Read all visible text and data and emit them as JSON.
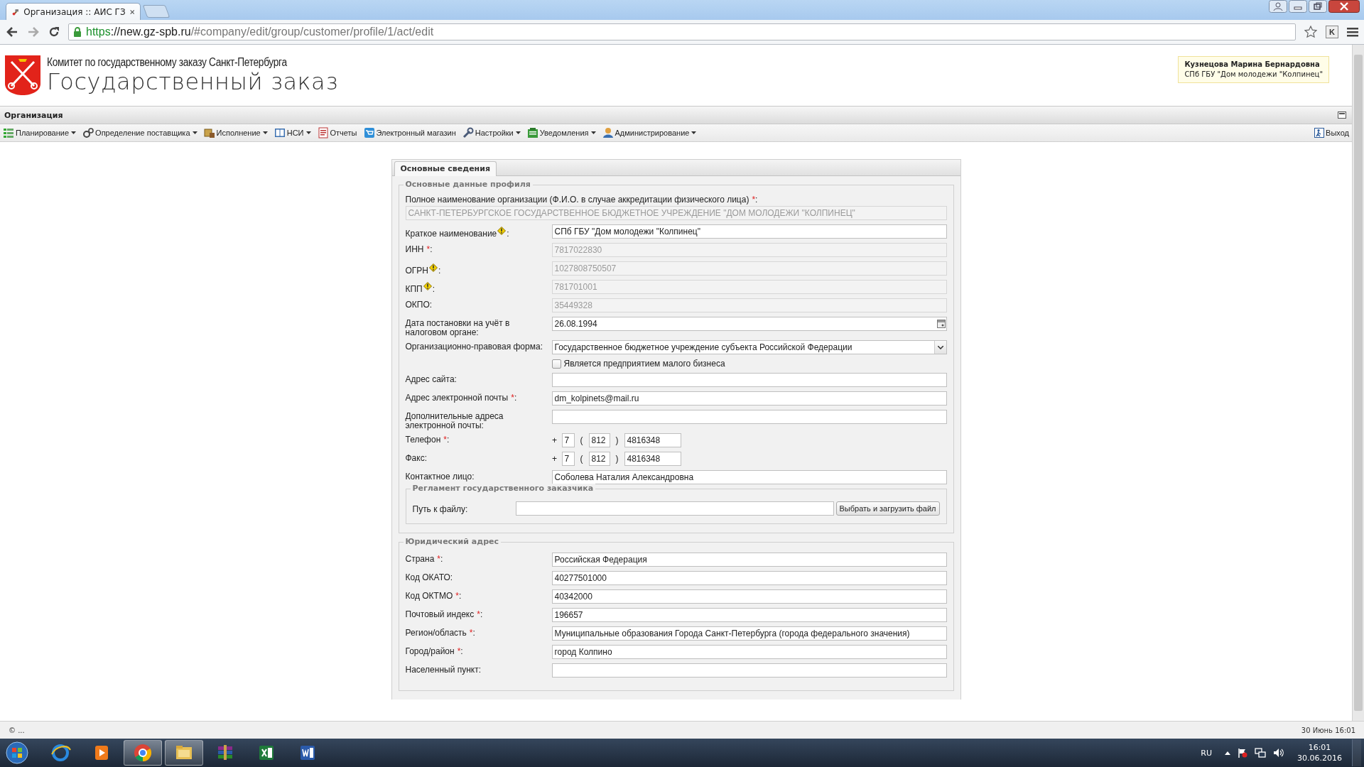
{
  "browser": {
    "tab_title": "Организация :: АИС ГЗ",
    "url_scheme": "https",
    "url_rest": "://new.gz-spb.ru",
    "url_path": "/#company/edit/group/customer/profile/1/act/edit",
    "ext_label": "K"
  },
  "header": {
    "subtitle": "Комитет по государственному заказу Санкт-Петербурга",
    "title": "Государственный заказ",
    "user_name": "Кузнецова Марина Бернардовна",
    "user_org": "СПб ГБУ \"Дом молодежи \"Колпинец\""
  },
  "section_title": "Организация",
  "menu": [
    {
      "label": "Планирование",
      "dropdown": true
    },
    {
      "label": "Определение поставщика",
      "dropdown": true
    },
    {
      "label": "Исполнение",
      "dropdown": true
    },
    {
      "label": "НСИ",
      "dropdown": true
    },
    {
      "label": "Отчеты",
      "dropdown": false
    },
    {
      "label": "Электронный магазин",
      "dropdown": false
    },
    {
      "label": "Настройки",
      "dropdown": true
    },
    {
      "label": "Уведомления",
      "dropdown": true
    },
    {
      "label": "Администрирование",
      "dropdown": true
    }
  ],
  "logout": "Выход",
  "tabs": [
    {
      "label": "Основные сведения",
      "selected": true
    }
  ],
  "fieldsets": [
    {
      "legend": "Основные данные профиля",
      "fields": [
        {
          "kind": "wide",
          "label": "Полное наименование организации (Ф.И.О. в случае аккредитации физического лица)",
          "mark": "*",
          "tail": ":",
          "value": "САНКТ-ПЕТЕРБУРГСКОЕ ГОСУДАРСТВЕННОЕ БЮДЖЕТНОЕ УЧРЕЖДЕНИЕ \"ДОМ МОЛОДЕЖИ \"КОЛПИНЕЦ\"",
          "disabled": true
        },
        {
          "kind": "text",
          "label": "Краткое наименование",
          "warning": true,
          "tail": ":",
          "value": "СПб ГБУ \"Дом молодежи \"Колпинец\"",
          "disabled": false
        },
        {
          "kind": "text",
          "label": "ИНН",
          "mark": "*",
          "tail": ":",
          "value": "7817022830",
          "disabled": true
        },
        {
          "kind": "text",
          "label": "ОГРН",
          "warning": true,
          "tail": ":",
          "value": "1027808750507",
          "disabled": true
        },
        {
          "kind": "text",
          "label": "КПП",
          "warning": true,
          "tail": ":",
          "value": "781701001",
          "disabled": true
        },
        {
          "kind": "text",
          "label": "ОКПО:",
          "value": "35449328",
          "disabled": true
        },
        {
          "kind": "date",
          "label": "Дата постановки на учёт в налоговом органе:",
          "value": "26.08.1994",
          "disabled": false
        },
        {
          "kind": "select",
          "label": "Организационно-правовая форма:",
          "value": "Государственное бюджетное учреждение субъекта Российской Федерации",
          "disabled": false
        },
        {
          "kind": "checkbox",
          "label": "Является предприятием малого бизнеса",
          "checked": false
        },
        {
          "kind": "text",
          "label": "Адрес сайта:",
          "disabled": false
        },
        {
          "kind": "text",
          "label": "Адрес электронной почты",
          "mark": "*",
          "tail": ":",
          "value": "dm_kolpinets@mail.ru",
          "disabled": false
        },
        {
          "kind": "text",
          "label": "Дополнительные адреса электронной почты:",
          "disabled": false
        },
        {
          "kind": "phone",
          "label": "Телефон",
          "mark": "*",
          "tail": ":",
          "plus": "+",
          "open": "(",
          "close": ")",
          "country": "7",
          "area": "812",
          "number": "4816348"
        },
        {
          "kind": "phone",
          "label": "Факс:",
          "plus": "+",
          "open": "(",
          "close": ")",
          "country": "7",
          "area": "812",
          "number": "4816348"
        },
        {
          "kind": "text",
          "label": "Контактное лицо:",
          "value": "Соболева Наталия Александровна",
          "disabled": false
        },
        {
          "kind": "file",
          "legend": "Регламент государственного заказчика",
          "label": "Путь к файлу:",
          "button": "Выбрать и загрузить файл"
        }
      ]
    },
    {
      "legend": "Юридический адрес",
      "fields": [
        {
          "kind": "text",
          "label": "Страна",
          "mark": "*",
          "tail": ":",
          "value": "Российская Федерация",
          "disabled": false
        },
        {
          "kind": "text",
          "label": "Код ОКАТО:",
          "value": "40277501000",
          "disabled": false
        },
        {
          "kind": "text",
          "label": "Код ОКТМО",
          "mark": "*",
          "tail": ":",
          "value": "40342000",
          "disabled": false
        },
        {
          "kind": "text",
          "label": "Почтовый индекс",
          "mark": "*",
          "tail": ":",
          "value": "196657",
          "disabled": false
        },
        {
          "kind": "text",
          "label": "Регион/область",
          "mark": "*",
          "tail": ":",
          "value": "Муниципальные образования Города Санкт-Петербурга (города федерального значения)",
          "disabled": false
        },
        {
          "kind": "text",
          "label": "Город/район",
          "mark": "*",
          "tail": ":",
          "value": "город Колпино",
          "disabled": false
        },
        {
          "kind": "text",
          "label": "Населенный пункт:",
          "disabled": false
        }
      ]
    }
  ],
  "status_bar": {
    "left": "© ...",
    "right": "30 Июнь 16:01"
  },
  "taskbar": {
    "language": "RU",
    "time": "16:01",
    "date": "30.06.2016"
  }
}
